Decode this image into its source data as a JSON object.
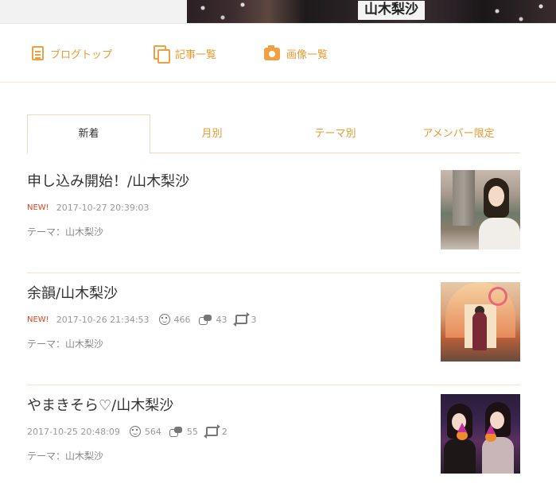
{
  "banner": {
    "title": "山木梨沙"
  },
  "topnav": {
    "items": [
      {
        "label": "ブログトップ",
        "icon": "document-icon"
      },
      {
        "label": "記事一覧",
        "icon": "copy-icon"
      },
      {
        "label": "画像一覧",
        "icon": "camera-icon"
      }
    ]
  },
  "tabs": [
    {
      "label": "新着",
      "active": true
    },
    {
      "label": "月別",
      "active": false
    },
    {
      "label": "テーマ別",
      "active": false
    },
    {
      "label": "アメンバー限定",
      "active": false
    }
  ],
  "entries": [
    {
      "title": "申し込み開始！/山木梨沙",
      "new_badge": "NEW!",
      "datetime": "2017-10-27 20:39:03",
      "likes": "",
      "comments": "",
      "reblogs": "",
      "theme": "テーマ：山木梨沙"
    },
    {
      "title": "余韻/山木梨沙",
      "new_badge": "NEW!",
      "datetime": "2017-10-26 21:34:53",
      "likes": "466",
      "comments": "43",
      "reblogs": "3",
      "theme": "テーマ：山木梨沙"
    },
    {
      "title": "やまきそら♡/山木梨沙",
      "new_badge": "",
      "datetime": "2017-10-25 20:48:09",
      "likes": "564",
      "comments": "55",
      "reblogs": "2",
      "theme": "テーマ：山木梨沙"
    }
  ],
  "colors": {
    "accent": "#e8992e",
    "new_badge": "#d9461e",
    "divider": "#f7e3cb"
  }
}
